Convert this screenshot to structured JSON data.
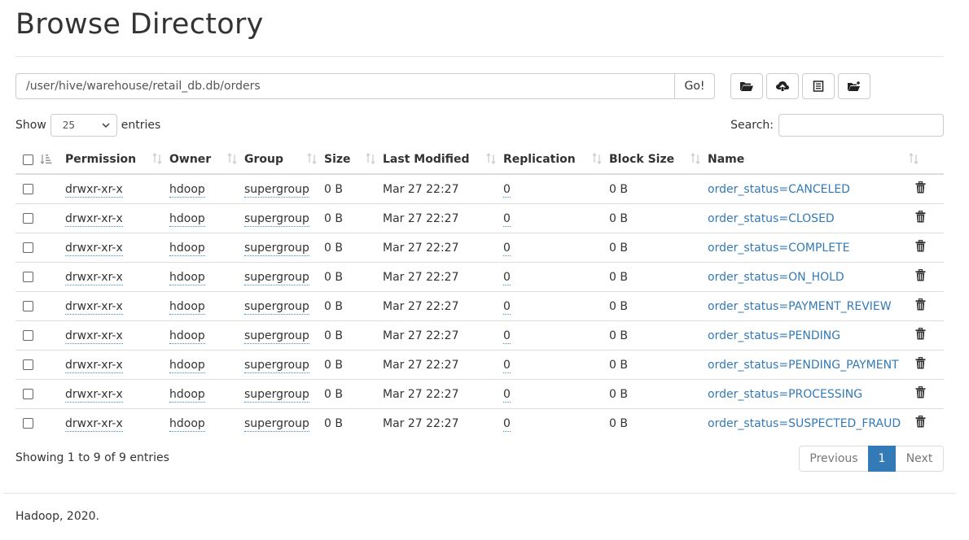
{
  "page": {
    "title": "Browse Directory"
  },
  "path_bar": {
    "value": "/user/hive/warehouse/retail_db.db/orders",
    "go_label": "Go!"
  },
  "toolbar": {
    "icons": [
      "folder-open-icon",
      "cloud-upload-icon",
      "list-icon",
      "create-folder-icon"
    ]
  },
  "length": {
    "show_label": "Show",
    "selected": "25",
    "entries_label": "entries"
  },
  "search": {
    "label": "Search:",
    "value": ""
  },
  "table": {
    "headers": [
      "Permission",
      "Owner",
      "Group",
      "Size",
      "Last Modified",
      "Replication",
      "Block Size",
      "Name"
    ],
    "rows": [
      {
        "permission": "drwxr-xr-x",
        "owner": "hdoop",
        "group": "supergroup",
        "size": "0 B",
        "modified": "Mar 27 22:27",
        "replication": "0",
        "block_size": "0 B",
        "name": "order_status=CANCELED"
      },
      {
        "permission": "drwxr-xr-x",
        "owner": "hdoop",
        "group": "supergroup",
        "size": "0 B",
        "modified": "Mar 27 22:27",
        "replication": "0",
        "block_size": "0 B",
        "name": "order_status=CLOSED"
      },
      {
        "permission": "drwxr-xr-x",
        "owner": "hdoop",
        "group": "supergroup",
        "size": "0 B",
        "modified": "Mar 27 22:27",
        "replication": "0",
        "block_size": "0 B",
        "name": "order_status=COMPLETE"
      },
      {
        "permission": "drwxr-xr-x",
        "owner": "hdoop",
        "group": "supergroup",
        "size": "0 B",
        "modified": "Mar 27 22:27",
        "replication": "0",
        "block_size": "0 B",
        "name": "order_status=ON_HOLD"
      },
      {
        "permission": "drwxr-xr-x",
        "owner": "hdoop",
        "group": "supergroup",
        "size": "0 B",
        "modified": "Mar 27 22:27",
        "replication": "0",
        "block_size": "0 B",
        "name": "order_status=PAYMENT_REVIEW"
      },
      {
        "permission": "drwxr-xr-x",
        "owner": "hdoop",
        "group": "supergroup",
        "size": "0 B",
        "modified": "Mar 27 22:27",
        "replication": "0",
        "block_size": "0 B",
        "name": "order_status=PENDING"
      },
      {
        "permission": "drwxr-xr-x",
        "owner": "hdoop",
        "group": "supergroup",
        "size": "0 B",
        "modified": "Mar 27 22:27",
        "replication": "0",
        "block_size": "0 B",
        "name": "order_status=PENDING_PAYMENT"
      },
      {
        "permission": "drwxr-xr-x",
        "owner": "hdoop",
        "group": "supergroup",
        "size": "0 B",
        "modified": "Mar 27 22:27",
        "replication": "0",
        "block_size": "0 B",
        "name": "order_status=PROCESSING"
      },
      {
        "permission": "drwxr-xr-x",
        "owner": "hdoop",
        "group": "supergroup",
        "size": "0 B",
        "modified": "Mar 27 22:27",
        "replication": "0",
        "block_size": "0 B",
        "name": "order_status=SUSPECTED_FRAUD"
      }
    ]
  },
  "info": "Showing 1 to 9 of 9 entries",
  "pagination": {
    "previous": "Previous",
    "current": "1",
    "next": "Next"
  },
  "footer": "Hadoop, 2020.",
  "colors": {
    "link": "#337ab7",
    "active_page": "#337ab7",
    "border": "#dddddd"
  }
}
